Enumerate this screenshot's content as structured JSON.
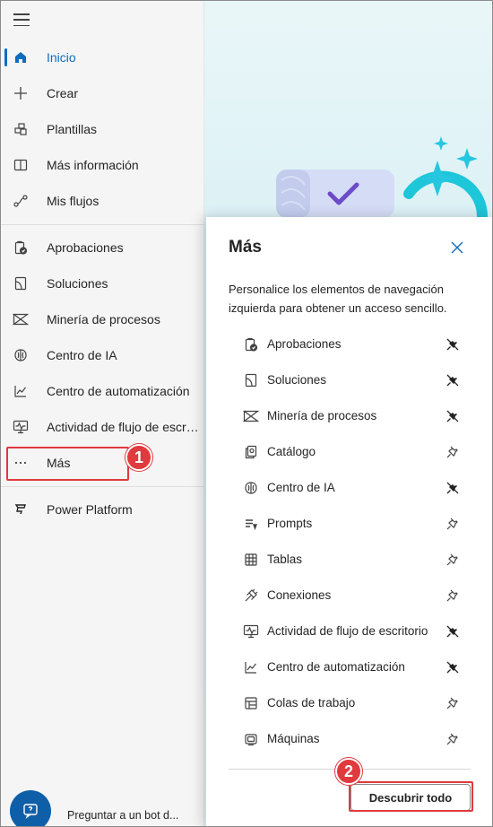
{
  "sidebar": {
    "items": [
      {
        "label": "Inicio",
        "icon": "home-icon",
        "active": true
      },
      {
        "label": "Crear",
        "icon": "plus-icon"
      },
      {
        "label": "Plantillas",
        "icon": "templates-icon"
      },
      {
        "label": "Más información",
        "icon": "book-icon"
      },
      {
        "label": "Mis flujos",
        "icon": "flow-icon"
      },
      {
        "label": "Aprobaciones",
        "icon": "approvals-icon"
      },
      {
        "label": "Soluciones",
        "icon": "solutions-icon"
      },
      {
        "label": "Minería de procesos",
        "icon": "process-mining-icon"
      },
      {
        "label": "Centro de IA",
        "icon": "ai-hub-icon"
      },
      {
        "label": "Centro de automatización",
        "icon": "chart-icon"
      },
      {
        "label": "Actividad de flujo de escritorio",
        "icon": "desktop-activity-icon"
      },
      {
        "label": "Más",
        "icon": "more-icon"
      },
      {
        "label": "Power Platform",
        "icon": "power-platform-icon"
      }
    ],
    "bot_label": "Preguntar a un bot d..."
  },
  "badges": {
    "one": "1",
    "two": "2"
  },
  "panel": {
    "title": "Más",
    "description": "Personalice los elementos de navegación izquierda para obtener un acceso sencillo.",
    "items": [
      {
        "label": "Aprobaciones",
        "icon": "approvals-icon",
        "pinned": true
      },
      {
        "label": "Soluciones",
        "icon": "solutions-icon",
        "pinned": true
      },
      {
        "label": "Minería de procesos",
        "icon": "process-mining-icon",
        "pinned": true
      },
      {
        "label": "Catálogo",
        "icon": "catalog-icon",
        "pinned": false
      },
      {
        "label": "Centro de IA",
        "icon": "ai-hub-icon",
        "pinned": true
      },
      {
        "label": "Prompts",
        "icon": "prompts-icon",
        "pinned": false
      },
      {
        "label": "Tablas",
        "icon": "table-icon",
        "pinned": false
      },
      {
        "label": "Conexiones",
        "icon": "connections-icon",
        "pinned": false
      },
      {
        "label": "Actividad de flujo de escritorio",
        "icon": "desktop-activity-icon",
        "pinned": true
      },
      {
        "label": "Centro de automatización",
        "icon": "chart-icon",
        "pinned": true
      },
      {
        "label": "Colas de trabajo",
        "icon": "work-queue-icon",
        "pinned": false
      },
      {
        "label": "Máquinas",
        "icon": "machines-icon",
        "pinned": false
      }
    ],
    "discover_label": "Descubrir todo"
  },
  "colors": {
    "accent": "#0f6cbd",
    "highlight": "#e0393e"
  }
}
